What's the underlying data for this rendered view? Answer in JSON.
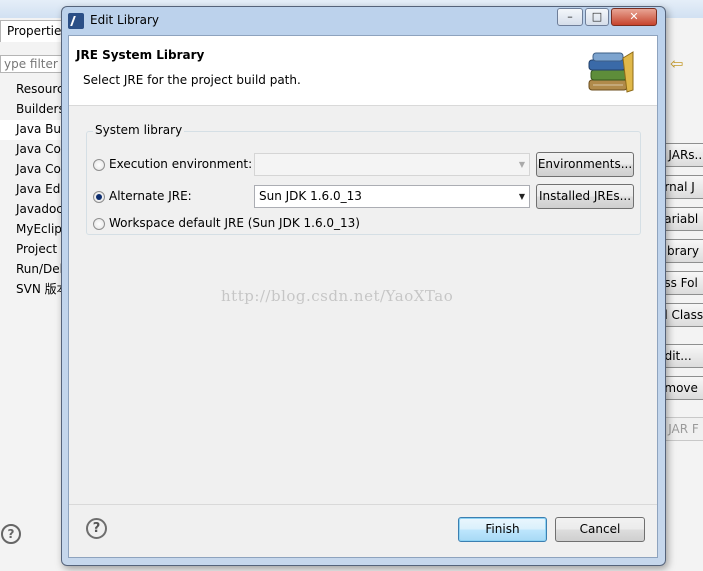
{
  "background": {
    "tab_title": "Propertie",
    "filter_placeholder": "ype filter te",
    "tree_items": [
      "Resourc",
      "Builders",
      "Java Bu",
      "Java Co",
      "Java Co",
      "Java Ed",
      "Javadoc",
      "MyEclip",
      "Project",
      "Run/Del",
      "SVN 版本"
    ],
    "right_buttons": [
      "d JARs..",
      "ernal J",
      "Variabl",
      "Library",
      "ass Fol",
      "al Class",
      "Edit...",
      "emove",
      "e JAR F"
    ]
  },
  "dialog": {
    "title": "Edit Library",
    "window_controls": {
      "minimize": "–",
      "maximize": "□",
      "close": "✕"
    },
    "banner": {
      "title": "JRE System Library",
      "description": "Select JRE for the project build path."
    },
    "group_label": "System library",
    "options": {
      "execution_env": {
        "label": "Execution environment:",
        "value": "",
        "button": "Environments...",
        "selected": false
      },
      "alternate_jre": {
        "label": "Alternate JRE:",
        "value": "Sun JDK 1.6.0_13",
        "button": "Installed JREs...",
        "selected": true
      },
      "workspace_default": {
        "label": "Workspace default JRE (Sun JDK 1.6.0_13)",
        "selected": false
      }
    },
    "footer": {
      "help": "?",
      "finish": "Finish",
      "cancel": "Cancel"
    }
  },
  "watermark": "http://blog.csdn.net/YaoXTao"
}
